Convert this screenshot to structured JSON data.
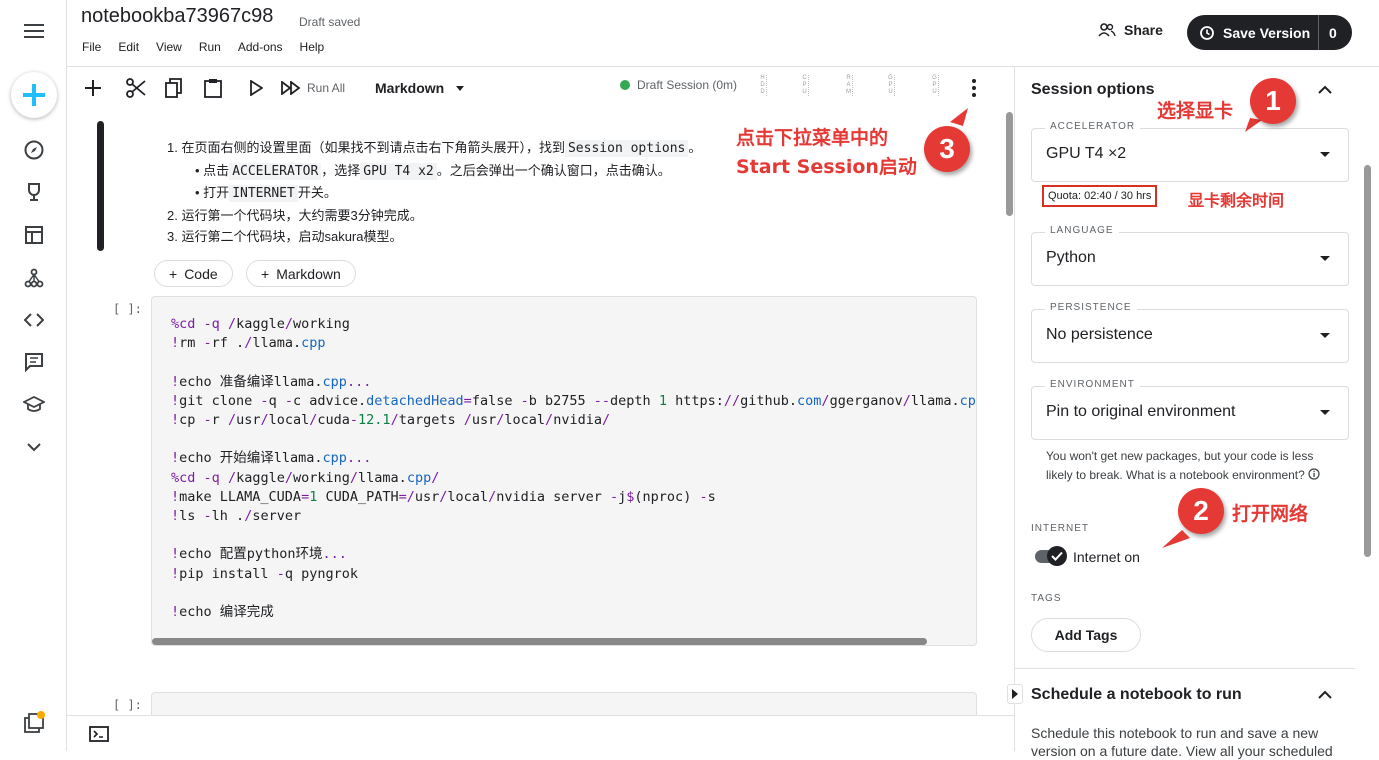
{
  "app": {
    "notebook_title": "notebookba73967c98",
    "save_status": "Draft saved"
  },
  "menu": [
    "File",
    "Edit",
    "View",
    "Run",
    "Add-ons",
    "Help"
  ],
  "header": {
    "share_label": "Share",
    "save_version_label": "Save Version",
    "save_version_count": "0"
  },
  "toolbar": {
    "run_all_label": "Run All",
    "cell_type": "Markdown",
    "session_status": "Draft Session (0m)",
    "resources": [
      "HDD",
      "CPU",
      "RAM",
      "GPU",
      "GPU"
    ]
  },
  "markdown_cell": {
    "item1_pre": "在页面右侧的设置里面（如果找不到请点击右下角箭头展开），找到",
    "item1_code": "Session options",
    "item1_post": "。",
    "sub1_pre": "点击",
    "sub1_code1": "ACCELERATOR",
    "sub1_mid": "，选择",
    "sub1_code2": "GPU T4 x2",
    "sub1_post": "。之后会弹出一个确认窗口，点击确认。",
    "sub2_pre": "打开",
    "sub2_code": "INTERNET",
    "sub2_post": "开关。",
    "item2": "运行第一个代码块，大约需要3分钟完成。",
    "item3": "运行第二个代码块，启动sakura模型。"
  },
  "add_buttons": {
    "code": "Code",
    "markdown": "Markdown"
  },
  "code_cells": [
    {
      "exec_count": "[ ]:"
    },
    {
      "exec_count": "[ ]:"
    }
  ],
  "panel": {
    "session_title": "Session options",
    "accelerator": {
      "label": "ACCELERATOR",
      "value": "GPU T4 ×2"
    },
    "quota": "Quota: 02:40 / 30 hrs",
    "language": {
      "label": "LANGUAGE",
      "value": "Python"
    },
    "persistence": {
      "label": "PERSISTENCE",
      "value": "No persistence"
    },
    "environment": {
      "label": "ENVIRONMENT",
      "value": "Pin to original environment"
    },
    "env_help": "You won't get new packages, but your code is less likely to break. What is a notebook environment?",
    "internet_label": "INTERNET",
    "internet_value": "Internet on",
    "tags_label": "TAGS",
    "add_tags": "Add Tags",
    "schedule_title": "Schedule a notebook to run",
    "schedule_desc": "Schedule this notebook to run and save a new version on a future date. View all your scheduled"
  },
  "annotations": {
    "a1_num": "1",
    "a1_text": "选择显卡",
    "quota_note": "显卡剩余时间",
    "a2_num": "2",
    "a2_text": "打开网络",
    "a3_num": "3",
    "a3_line1": "点击下拉菜单中的",
    "a3_line2": "Start Session启动"
  },
  "colors": {
    "accent": "#20beff",
    "annotation": "#e53935",
    "dark": "#202124"
  }
}
